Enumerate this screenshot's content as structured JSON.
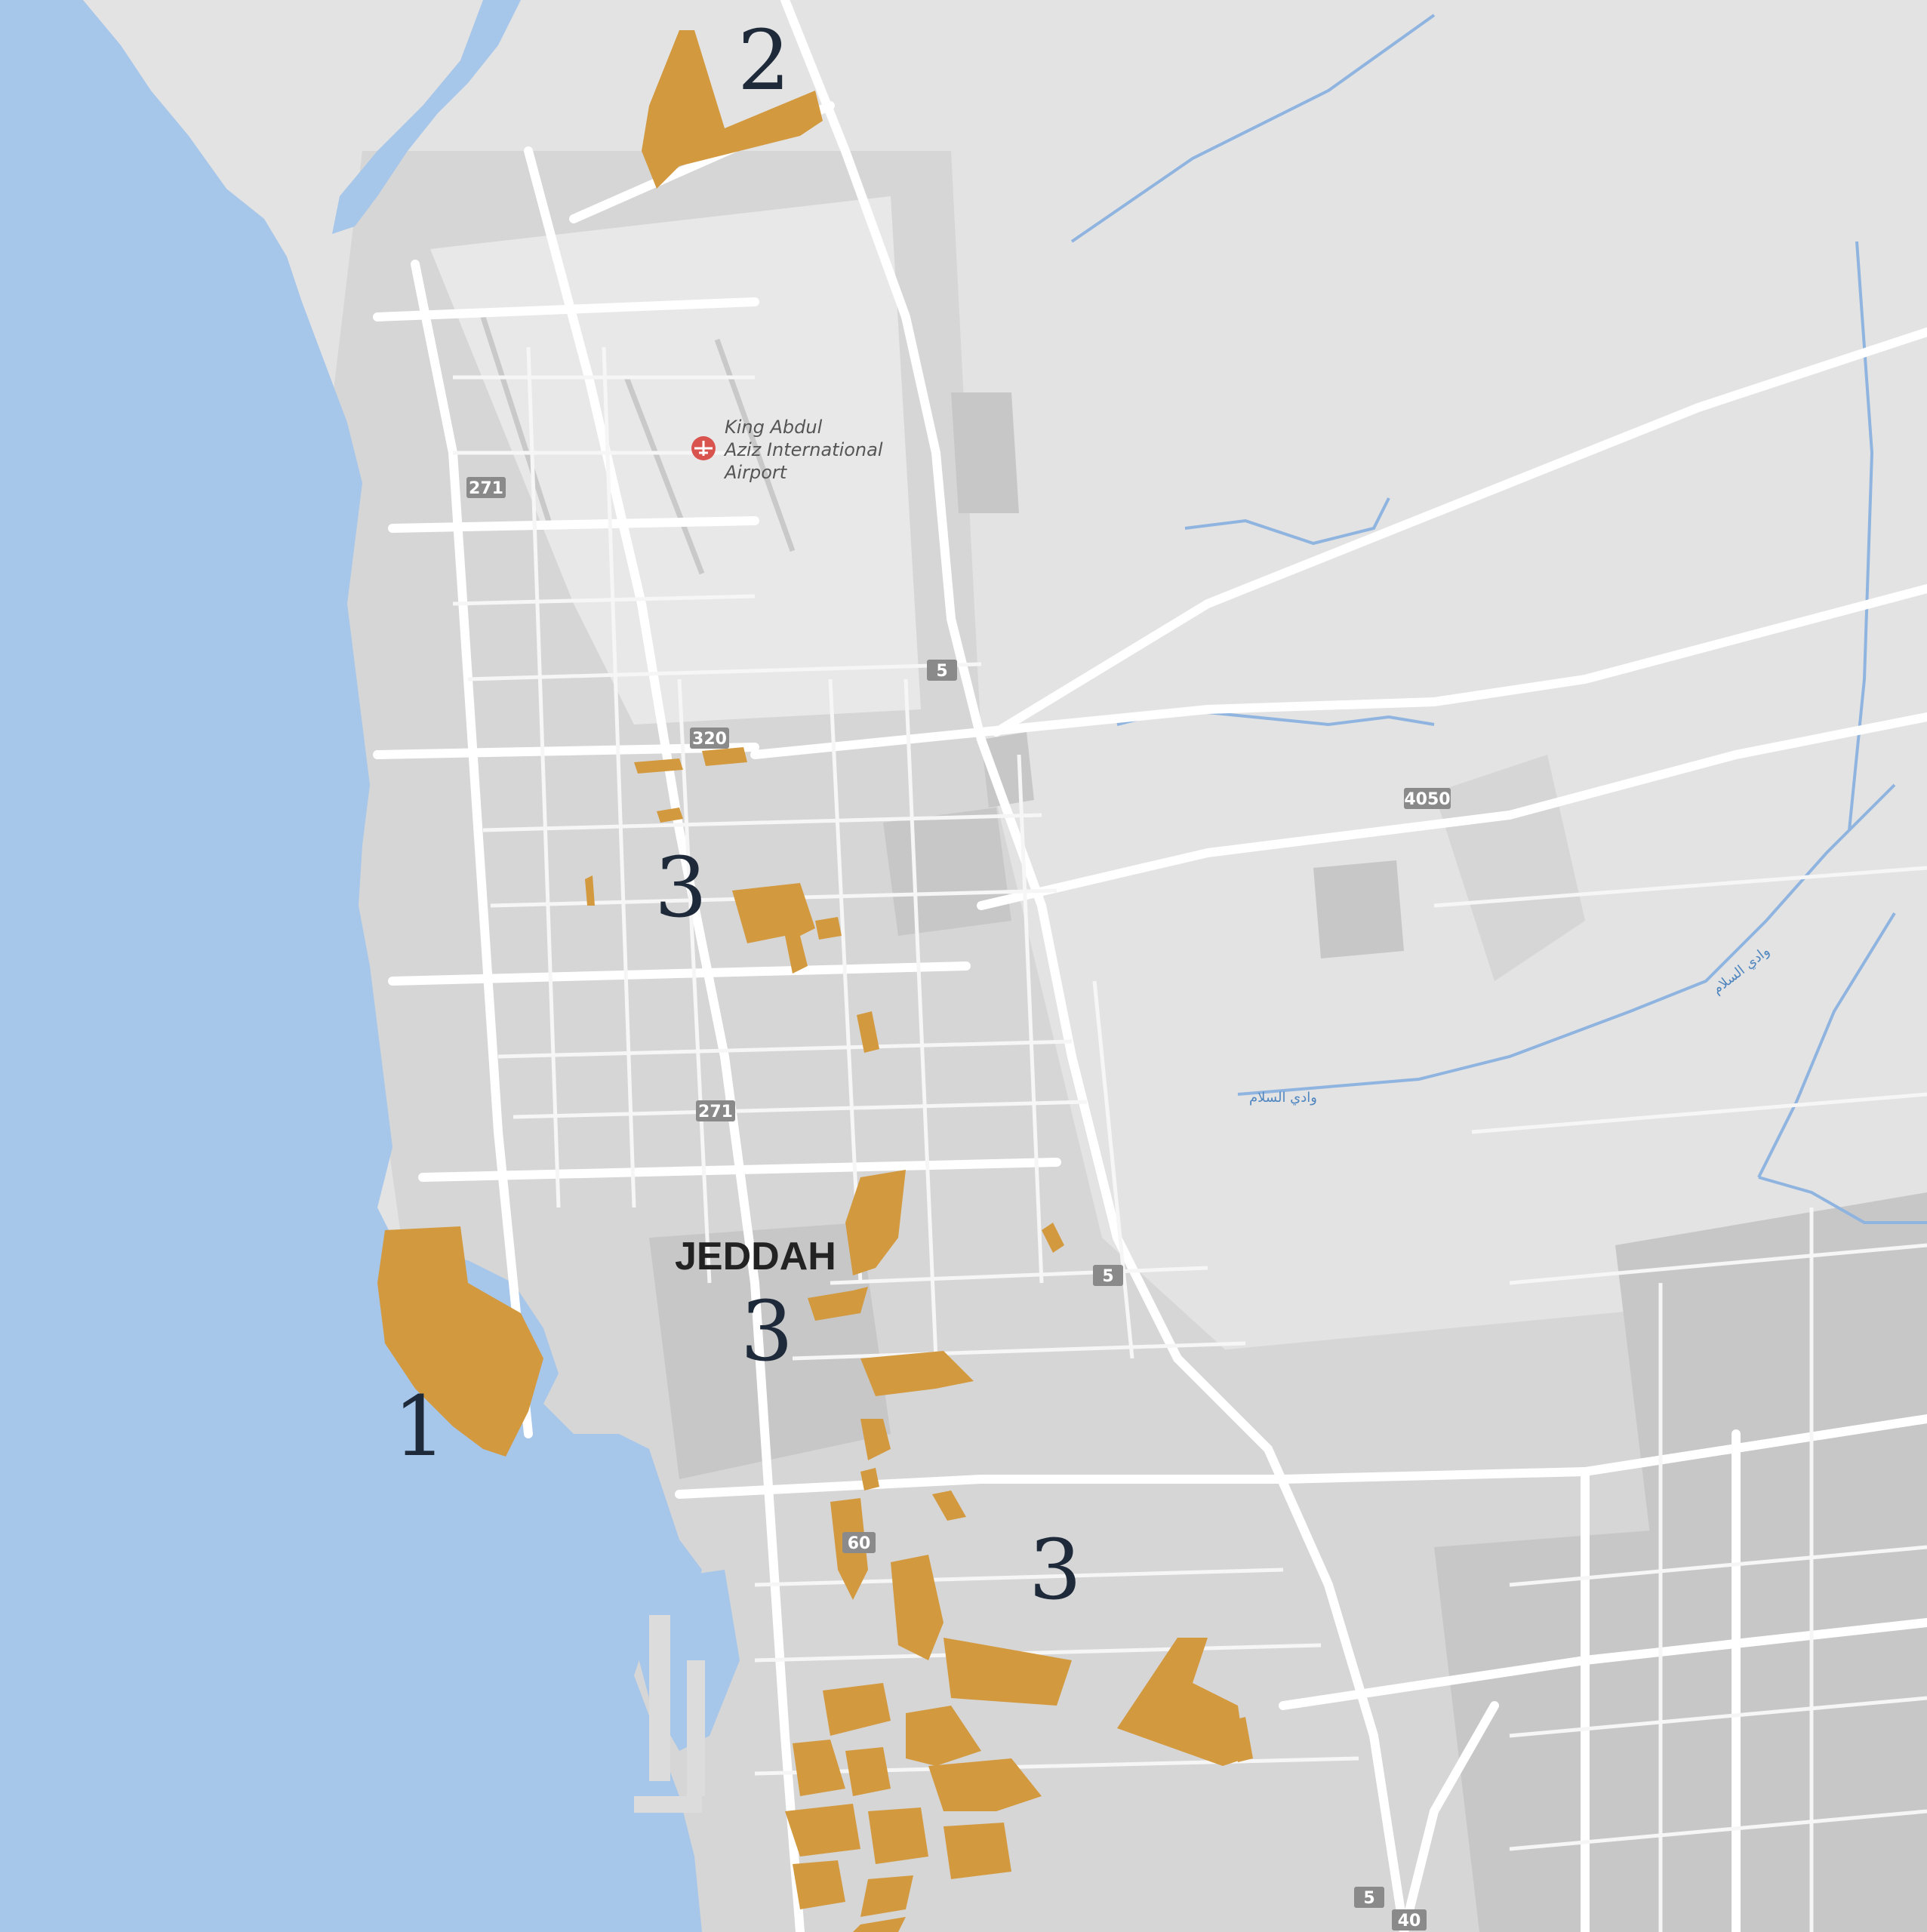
{
  "map": {
    "city_label": "JEDDAH",
    "airport": {
      "label_lines": [
        "King Abdul",
        "Aziz International",
        "Airport"
      ],
      "icon": "airport-icon"
    },
    "route_shields": [
      {
        "id": "shield-271-north",
        "label": "271"
      },
      {
        "id": "shield-271-south",
        "label": "271"
      },
      {
        "id": "shield-320",
        "label": "320"
      },
      {
        "id": "shield-5-north",
        "label": "5"
      },
      {
        "id": "shield-5-mid",
        "label": "5"
      },
      {
        "id": "shield-5-south",
        "label": "5"
      },
      {
        "id": "shield-4050",
        "label": "4050"
      },
      {
        "id": "shield-60",
        "label": "60"
      },
      {
        "id": "shield-40",
        "label": "40"
      }
    ],
    "wadi_labels": [
      {
        "id": "wadi-label-east",
        "label": "وادي السلام"
      },
      {
        "id": "wadi-label-center",
        "label": "وادي السلام"
      }
    ],
    "zones": [
      {
        "id": "zone-1",
        "label": "1"
      },
      {
        "id": "zone-2",
        "label": "2"
      },
      {
        "id": "zone-3-north",
        "label": "3"
      },
      {
        "id": "zone-3-center",
        "label": "3"
      },
      {
        "id": "zone-3-south",
        "label": "3"
      }
    ],
    "colors": {
      "sea": "#a6c6ea",
      "land": "#e3e3e3",
      "urban": "#d3d3d3",
      "road": "#ffffff",
      "river": "#8fb4e0",
      "zone": "#d3993f",
      "zone_label": "#1e2a3a",
      "shield": "#8a8a8a",
      "airport_icon": "#d9534f"
    }
  }
}
